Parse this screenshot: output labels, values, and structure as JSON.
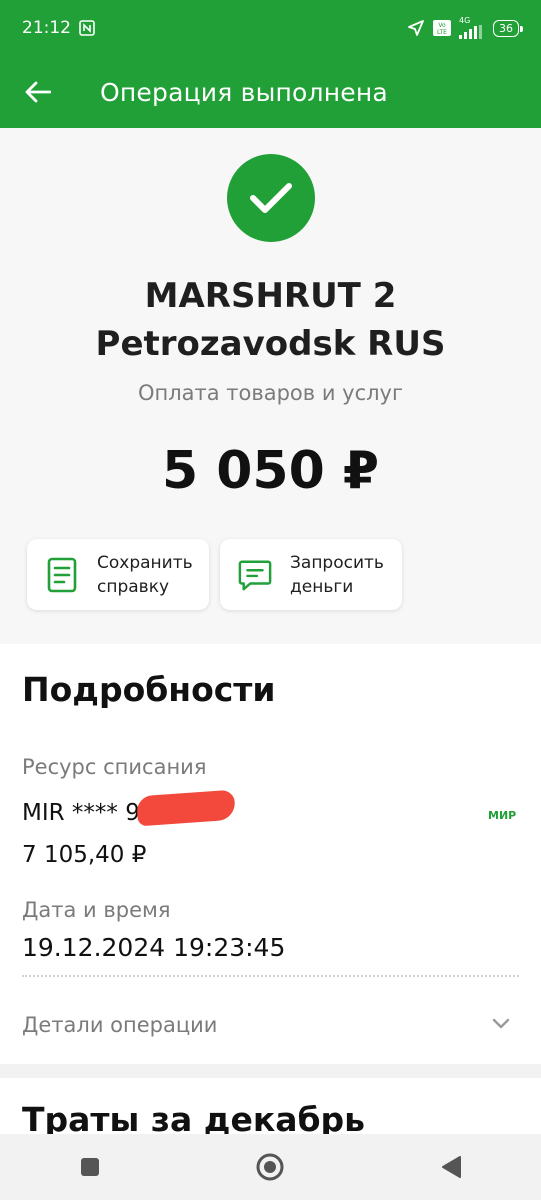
{
  "status_bar": {
    "time": "21:12",
    "network": "4G",
    "battery": "36",
    "icons": [
      "nfc-icon",
      "location-arrow-icon",
      "volte-icon",
      "signal-icon",
      "battery-icon"
    ]
  },
  "app_bar": {
    "title": "Операция выполнена",
    "back_icon": "arrow-left-icon"
  },
  "operation": {
    "merchant_line1": "MARSHRUT 2",
    "merchant_line2": "Petrozavodsk RUS",
    "type": "Оплата товаров и услуг",
    "amount": "5 050 ₽",
    "status_icon": "check-circle-icon"
  },
  "actions": [
    {
      "label": "Сохранить\nсправку",
      "icon": "document-icon"
    },
    {
      "label": "Запросить\nденьги",
      "icon": "message-icon"
    }
  ],
  "details": {
    "title": "Подробности",
    "resource_label": "Ресурс списания",
    "card_mask": "MIR **** 9",
    "card_brand": "МИР",
    "balance": "7 105,40 ₽",
    "datetime_label": "Дата и время",
    "datetime_value": "19.12.2024 19:23:45",
    "operation_details_label": "Детали операции"
  },
  "spending": {
    "title": "Траты за декабрь"
  },
  "colors": {
    "brand_green": "#21a038",
    "background": "#f2f2f2",
    "redaction": "#f2493c"
  }
}
